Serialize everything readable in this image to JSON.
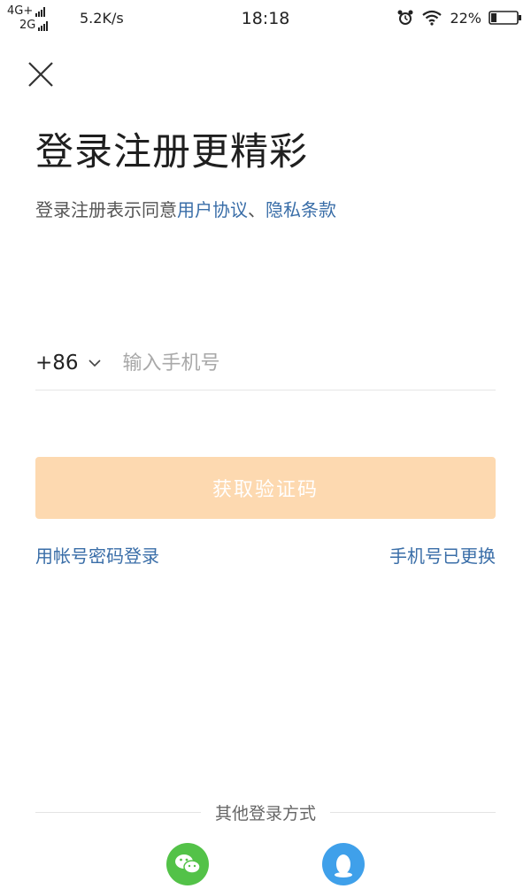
{
  "status_bar": {
    "network_1": "4G+",
    "network_2": "2G",
    "speed": "5.2K/s",
    "time": "18:18",
    "battery": "22%"
  },
  "header": {
    "close_icon": "close-icon"
  },
  "main": {
    "title": "登录注册更精彩",
    "agreement_prefix": "登录注册表示同意",
    "user_agreement": "用户协议",
    "separator": "、",
    "privacy_terms": "隐私条款"
  },
  "phone": {
    "country_code": "+86",
    "placeholder": "输入手机号"
  },
  "actions": {
    "get_code_label": "获取验证码",
    "account_password_login": "用帐号密码登录",
    "phone_changed": "手机号已更换"
  },
  "other_login": {
    "label": "其他登录方式",
    "wechat_icon": "wechat-icon",
    "qq_icon": "qq-icon"
  },
  "colors": {
    "accent_button": "#fdd9b0",
    "link": "#3a6ea8",
    "wechat": "#53c248",
    "qq": "#3fa0ea"
  }
}
